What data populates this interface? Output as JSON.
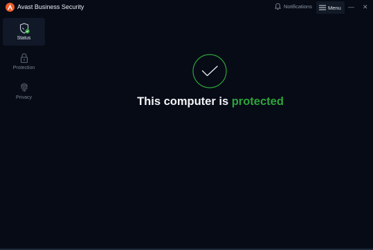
{
  "app": {
    "title": "Avast Business Security"
  },
  "titlebar": {
    "notifications_label": "Notifications",
    "menu_label": "Menu",
    "minimize_glyph": "—",
    "close_glyph": "✕"
  },
  "sidebar": {
    "items": [
      {
        "label": "Status",
        "icon": "shield-check-icon",
        "active": true
      },
      {
        "label": "Protection",
        "icon": "lock-icon",
        "active": false
      },
      {
        "label": "Privacy",
        "icon": "fingerprint-icon",
        "active": false
      }
    ]
  },
  "main": {
    "headline_prefix": "This computer is",
    "headline_status": "protected",
    "status_icon": "checkmark-icon"
  },
  "colors": {
    "accent_green": "#2ea43a",
    "brand_orange": "#f05a28",
    "background": "#070b16"
  }
}
